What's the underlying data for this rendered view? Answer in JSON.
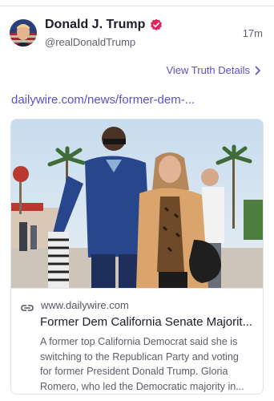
{
  "post": {
    "author": {
      "display_name": "Donald J. Trump",
      "handle": "@realDonaldTrump",
      "verified": true
    },
    "timestamp": "17m",
    "view_details_label": "View Truth Details",
    "link_text": "dailywire.com/news/former-dem-..."
  },
  "link_card": {
    "domain": "www.dailywire.com",
    "title": "Former Dem California Senate Majorit...",
    "description_lines": [
      "A former top California Democrat said she is",
      "switching to the Republican Party and voting",
      "for former President Donald Trump. Gloria",
      "Romero, who led the Democratic majority in..."
    ]
  },
  "colors": {
    "accent": "#5a4fcf",
    "verified_badge": "#e0245e",
    "text_primary": "#1b1b2a",
    "text_secondary": "#5f5f70"
  },
  "icons": {
    "verified": "verified-badge-icon",
    "chevron": "chevron-right-icon",
    "link": "link-icon"
  }
}
